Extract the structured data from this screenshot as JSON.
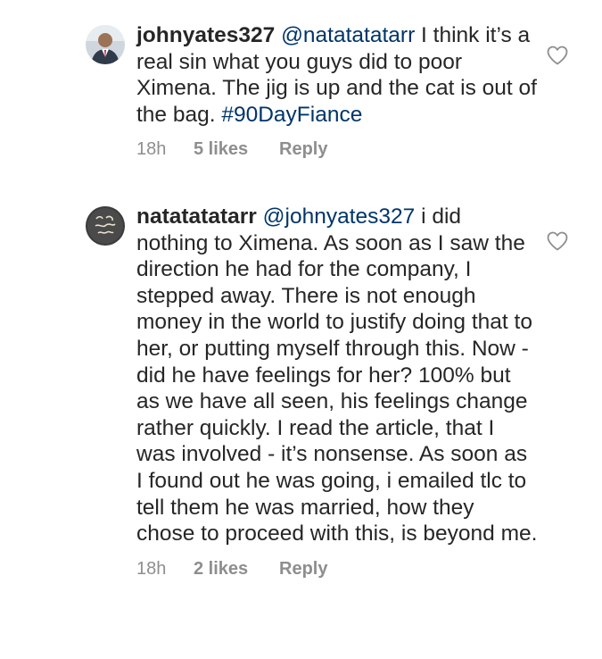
{
  "comments": [
    {
      "username": "johnyates327",
      "mention": "@natatatatarr",
      "text": " I think it’s a real sin what you guys did to poor Ximena. The jig is up and the cat is out of the bag. ",
      "hashtag": "#90DayFiance",
      "time": "18h",
      "likes": "5 likes",
      "reply": "Reply",
      "avatar_icon": "profile-photo-icon",
      "like_icon": "heart-outline-icon"
    },
    {
      "username": "natatatatarr",
      "mention": "@johnyates327",
      "text": " i did nothing to Ximena. As soon as I saw the direction he had for the company, I stepped away. There is not enough money in the world to justify doing that to her, or putting myself through this. Now - did he have feelings for her? 100% but as we have all seen, his feelings change rather quickly. I read the article, that I was involved - it’s nonsense. As soon as I found out he was going, i emailed tlc to tell them he was married, how they chose to proceed with this, is beyond me.",
      "time": "18h",
      "likes": "2 likes",
      "reply": "Reply",
      "avatar_icon": "profile-photo-icon",
      "like_icon": "heart-outline-icon"
    }
  ],
  "colors": {
    "text": "#262626",
    "link": "#003569",
    "meta": "#8e8e8e"
  }
}
